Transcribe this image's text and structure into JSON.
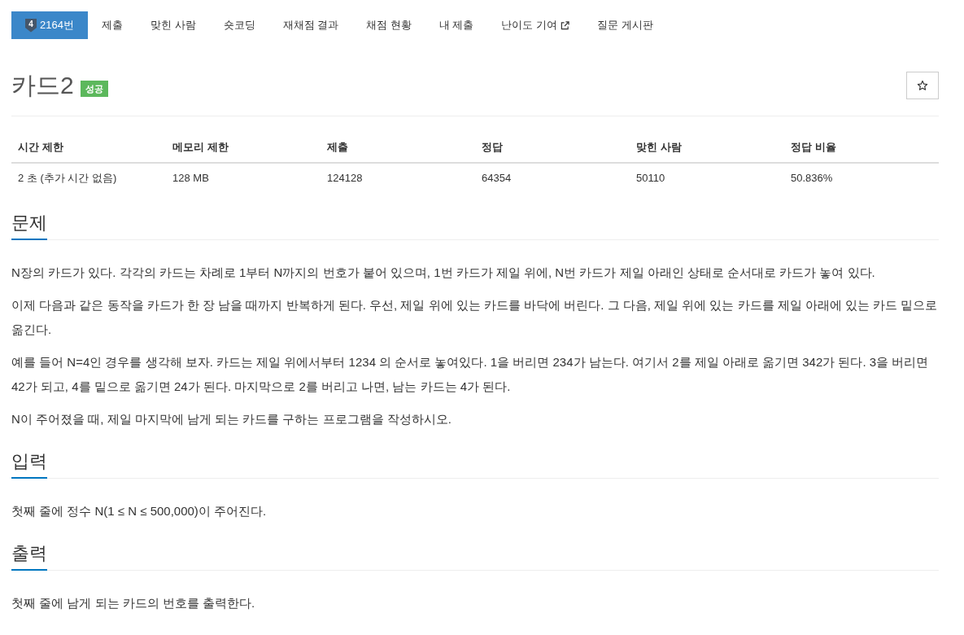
{
  "nav": {
    "tabs": [
      {
        "label": "2164번",
        "tier": "4",
        "selected": true,
        "external": false
      },
      {
        "label": "제출",
        "selected": false,
        "external": false
      },
      {
        "label": "맞힌 사람",
        "selected": false,
        "external": false
      },
      {
        "label": "숏코딩",
        "selected": false,
        "external": false
      },
      {
        "label": "재채점 결과",
        "selected": false,
        "external": false
      },
      {
        "label": "채점 현황",
        "selected": false,
        "external": false
      },
      {
        "label": "내 제출",
        "selected": false,
        "external": false
      },
      {
        "label": "난이도 기여",
        "selected": false,
        "external": true
      },
      {
        "label": "질문 게시판",
        "selected": false,
        "external": false
      }
    ]
  },
  "problem": {
    "title": "카드2",
    "status": {
      "label": "성공",
      "kind": "success"
    },
    "starred": false
  },
  "limits": {
    "columns": [
      "시간 제한",
      "메모리 제한",
      "제출",
      "정답",
      "맞힌 사람",
      "정답 비율"
    ],
    "rows": [
      [
        "2 초 (추가 시간 없음)",
        "128 MB",
        "124128",
        "64354",
        "50110",
        "50.836%"
      ]
    ]
  },
  "sections": [
    {
      "heading": "문제",
      "paragraphs": [
        "N장의 카드가 있다. 각각의 카드는 차례로 1부터 N까지의 번호가 붙어 있으며, 1번 카드가 제일 위에, N번 카드가 제일 아래인 상태로 순서대로 카드가 놓여 있다.",
        "이제 다음과 같은 동작을 카드가 한 장 남을 때까지 반복하게 된다. 우선, 제일 위에 있는 카드를 바닥에 버린다. 그 다음, 제일 위에 있는 카드를 제일 아래에 있는 카드 밑으로 옮긴다.",
        "예를 들어 N=4인 경우를 생각해 보자. 카드는 제일 위에서부터 1234 의 순서로 놓여있다. 1을 버리면 234가 남는다. 여기서 2를 제일 아래로 옮기면 342가 된다. 3을 버리면 42가 되고, 4를 밑으로 옮기면 24가 된다. 마지막으로 2를 버리고 나면, 남는 카드는 4가 된다.",
        "N이 주어졌을 때, 제일 마지막에 남게 되는 카드를 구하는 프로그램을 작성하시오."
      ]
    },
    {
      "heading": "입력",
      "paragraphs": [
        "첫째 줄에 정수 N(1 ≤ N ≤ 500,000)이 주어진다."
      ]
    },
    {
      "heading": "출력",
      "paragraphs": [
        "첫째 줄에 남게 되는 카드의 번호를 출력한다."
      ]
    }
  ]
}
